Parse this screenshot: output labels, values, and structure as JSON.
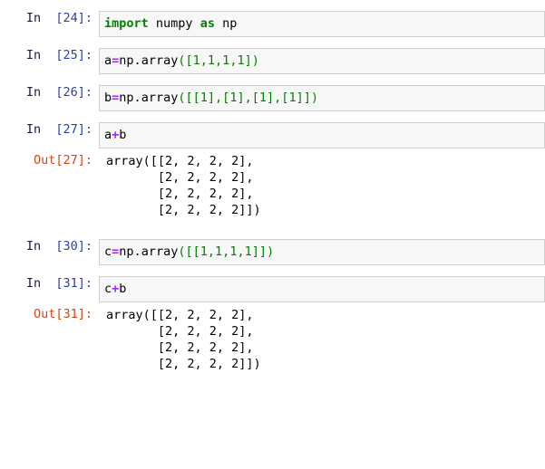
{
  "notebook": {
    "kernel_language": "python",
    "colors": {
      "input_background": "#f7f7f7",
      "input_border": "#cfcfcf",
      "page_background": "#ffffff",
      "prompt_in": "#303F9F",
      "prompt_out": "#D84315",
      "keyword": "#008000",
      "operator": "#AA22FF",
      "number": "#008000",
      "text": "#000000"
    },
    "cells": [
      {
        "type": "code",
        "prompt_in_label": "In",
        "prompt_in_number": "[24]:",
        "source_plain": "import numpy as np",
        "tokens": [
          {
            "t": "import",
            "k": "kw"
          },
          {
            "t": " ",
            "k": "ws"
          },
          {
            "t": "numpy",
            "k": "name"
          },
          {
            "t": " ",
            "k": "ws"
          },
          {
            "t": "as",
            "k": "kw"
          },
          {
            "t": " ",
            "k": "ws"
          },
          {
            "t": "np",
            "k": "name"
          }
        ],
        "output": null
      },
      {
        "type": "code",
        "prompt_in_label": "In",
        "prompt_in_number": "[25]:",
        "source_plain": "a=np.array([1,1,1,1])",
        "tokens": [
          {
            "t": "a",
            "k": "name"
          },
          {
            "t": "=",
            "k": "op"
          },
          {
            "t": "np",
            "k": "name"
          },
          {
            "t": ".",
            "k": "name"
          },
          {
            "t": "array",
            "k": "name"
          },
          {
            "t": "(",
            "k": "punc"
          },
          {
            "t": "[",
            "k": "punc"
          },
          {
            "t": "1",
            "k": "num"
          },
          {
            "t": ",",
            "k": "punc"
          },
          {
            "t": "1",
            "k": "num"
          },
          {
            "t": ",",
            "k": "punc"
          },
          {
            "t": "1",
            "k": "num"
          },
          {
            "t": ",",
            "k": "punc"
          },
          {
            "t": "1",
            "k": "num"
          },
          {
            "t": "]",
            "k": "punc"
          },
          {
            "t": ")",
            "k": "punc"
          }
        ],
        "output": null
      },
      {
        "type": "code",
        "prompt_in_label": "In",
        "prompt_in_number": "[26]:",
        "source_plain": "b=np.array([[1],[1],[1],[1]])",
        "tokens": [
          {
            "t": "b",
            "k": "name"
          },
          {
            "t": "=",
            "k": "op"
          },
          {
            "t": "np",
            "k": "name"
          },
          {
            "t": ".",
            "k": "name"
          },
          {
            "t": "array",
            "k": "name"
          },
          {
            "t": "(",
            "k": "punc"
          },
          {
            "t": "[",
            "k": "punc"
          },
          {
            "t": "[",
            "k": "punc"
          },
          {
            "t": "1",
            "k": "num"
          },
          {
            "t": "]",
            "k": "punc"
          },
          {
            "t": ",",
            "k": "punc"
          },
          {
            "t": "[",
            "k": "punc"
          },
          {
            "t": "1",
            "k": "num"
          },
          {
            "t": "]",
            "k": "punc"
          },
          {
            "t": ",",
            "k": "punc"
          },
          {
            "t": "[",
            "k": "punc"
          },
          {
            "t": "1",
            "k": "num"
          },
          {
            "t": "]",
            "k": "punc"
          },
          {
            "t": ",",
            "k": "punc"
          },
          {
            "t": "[",
            "k": "punc"
          },
          {
            "t": "1",
            "k": "num"
          },
          {
            "t": "]",
            "k": "punc"
          },
          {
            "t": "]",
            "k": "punc"
          },
          {
            "t": ")",
            "k": "punc"
          }
        ],
        "output": null
      },
      {
        "type": "code",
        "prompt_in_label": "In",
        "prompt_in_number": "[27]:",
        "source_plain": "a+b",
        "tokens": [
          {
            "t": "a",
            "k": "name"
          },
          {
            "t": "+",
            "k": "op"
          },
          {
            "t": "b",
            "k": "name"
          }
        ],
        "output": {
          "prompt_out_label": "Out",
          "prompt_out_number": "[27]:",
          "text": "array([[2, 2, 2, 2],\n       [2, 2, 2, 2],\n       [2, 2, 2, 2],\n       [2, 2, 2, 2]])"
        }
      },
      {
        "type": "code",
        "prompt_in_label": "In",
        "prompt_in_number": "[30]:",
        "source_plain": "c=np.array([[1,1,1,1]])",
        "tokens": [
          {
            "t": "c",
            "k": "name"
          },
          {
            "t": "=",
            "k": "op"
          },
          {
            "t": "np",
            "k": "name"
          },
          {
            "t": ".",
            "k": "name"
          },
          {
            "t": "array",
            "k": "name"
          },
          {
            "t": "(",
            "k": "punc"
          },
          {
            "t": "[",
            "k": "punc"
          },
          {
            "t": "[",
            "k": "punc"
          },
          {
            "t": "1",
            "k": "num"
          },
          {
            "t": ",",
            "k": "punc"
          },
          {
            "t": "1",
            "k": "num"
          },
          {
            "t": ",",
            "k": "punc"
          },
          {
            "t": "1",
            "k": "num"
          },
          {
            "t": ",",
            "k": "punc"
          },
          {
            "t": "1",
            "k": "num"
          },
          {
            "t": "]",
            "k": "punc"
          },
          {
            "t": "]",
            "k": "punc"
          },
          {
            "t": ")",
            "k": "punc"
          }
        ],
        "output": null
      },
      {
        "type": "code",
        "prompt_in_label": "In",
        "prompt_in_number": "[31]:",
        "source_plain": "c+b",
        "tokens": [
          {
            "t": "c",
            "k": "name"
          },
          {
            "t": "+",
            "k": "op"
          },
          {
            "t": "b",
            "k": "name"
          }
        ],
        "output": {
          "prompt_out_label": "Out",
          "prompt_out_number": "[31]:",
          "text": "array([[2, 2, 2, 2],\n       [2, 2, 2, 2],\n       [2, 2, 2, 2],\n       [2, 2, 2, 2]])"
        }
      }
    ]
  }
}
